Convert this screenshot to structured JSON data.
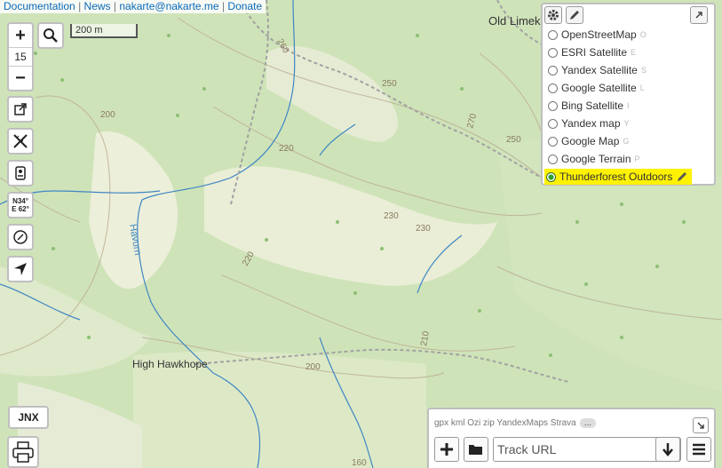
{
  "top_links": {
    "documentation": "Documentation",
    "news": "News",
    "email": "nakarte@nakarte.me",
    "donate": "Donate",
    "separator": "|"
  },
  "zoom": {
    "plus": "+",
    "level": "15",
    "minus": "−"
  },
  "scale_label": "200 m",
  "side_buttons": [
    {
      "name": "external-link-icon"
    },
    {
      "name": "ruler-icon"
    },
    {
      "name": "panoramas-icon"
    },
    {
      "name": "coordinates-button"
    },
    {
      "name": "azimuth-icon"
    },
    {
      "name": "locate-icon"
    }
  ],
  "coordinates": {
    "lat": "N34°",
    "lon": "E 62°"
  },
  "jnx_label": "JNX",
  "layers": {
    "items": [
      {
        "label": "OpenStreetMap",
        "hotkey": "O"
      },
      {
        "label": "ESRI Satellite",
        "hotkey": "E"
      },
      {
        "label": "Yandex Satellite",
        "hotkey": "S"
      },
      {
        "label": "Google Satellite",
        "hotkey": "L"
      },
      {
        "label": "Bing Satellite",
        "hotkey": "I"
      },
      {
        "label": "Yandex map",
        "hotkey": "Y"
      },
      {
        "label": "Google Map",
        "hotkey": "G"
      },
      {
        "label": "Google Terrain",
        "hotkey": "P"
      },
      {
        "label": "Thunderforest Outdoors",
        "hotkey": "",
        "selected": true
      }
    ]
  },
  "track": {
    "formats": "gpx kml Ozi zip YandexMaps Strava",
    "more": "...",
    "url_placeholder": "Track URL"
  },
  "map_labels": {
    "places": [
      "Old Limek",
      "High Hawkhope"
    ],
    "river": "Havurn",
    "contours": [
      "260",
      "250",
      "250",
      "200",
      "220",
      "270",
      "230",
      "230",
      "220",
      "200",
      "210",
      "160"
    ]
  },
  "colors": {
    "forest": "#cfe3b9",
    "open_land": "#eef0de",
    "water": "#3f86c4",
    "contour": "#b9aa90",
    "highlight": "#fff200"
  }
}
